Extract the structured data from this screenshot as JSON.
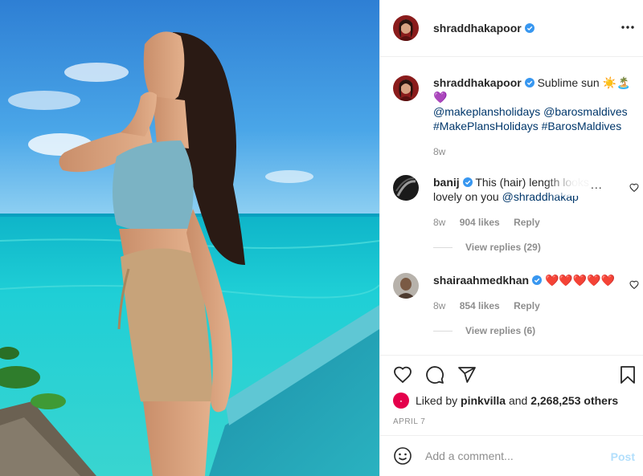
{
  "post": {
    "username": "shraddhakapoor",
    "verified": true,
    "more_icon": "more-horizontal-icon"
  },
  "caption": {
    "username": "shraddhakapoor",
    "text": "Sublime sun ☀️🏝️💜",
    "tags_line1": "@makeplansholidays @barosmaldives",
    "tags_line2": "#MakePlansHolidays #BarosMaldives",
    "age": "8w"
  },
  "comments": [
    {
      "username": "banij",
      "verified": true,
      "text_plain": "This (hair) length looks",
      "text_line2": "lovely on you ",
      "mention": "@shraddhakap",
      "overlay": "...",
      "age": "8w",
      "likes": "904 likes",
      "reply_label": "Reply",
      "view_replies": "View replies (29)"
    },
    {
      "username": "shairaahmedkhan",
      "verified": true,
      "text": "❤️❤️❤️❤️❤️",
      "age": "8w",
      "likes": "854 likes",
      "reply_label": "Reply",
      "view_replies": "View replies (6)"
    }
  ],
  "actions": {
    "like_icon": "heart-outline-icon",
    "comment_icon": "comment-bubble-icon",
    "share_icon": "paper-plane-icon",
    "save_icon": "bookmark-icon"
  },
  "likes": {
    "prefix": "Liked by ",
    "user": "pinkvilla",
    "middle": " and ",
    "others": "2,268,253 others"
  },
  "date": "APRIL 7",
  "add_comment": {
    "placeholder": "Add a comment...",
    "post_label": "Post",
    "emoji_icon": "smiley-icon"
  },
  "colors": {
    "link": "#00376b",
    "verified": "#3897f0",
    "muted": "#8e8e8e",
    "post_button_disabled": "#b2dffc",
    "sea": "#22c4cf",
    "sky": "#3a8fd8"
  }
}
